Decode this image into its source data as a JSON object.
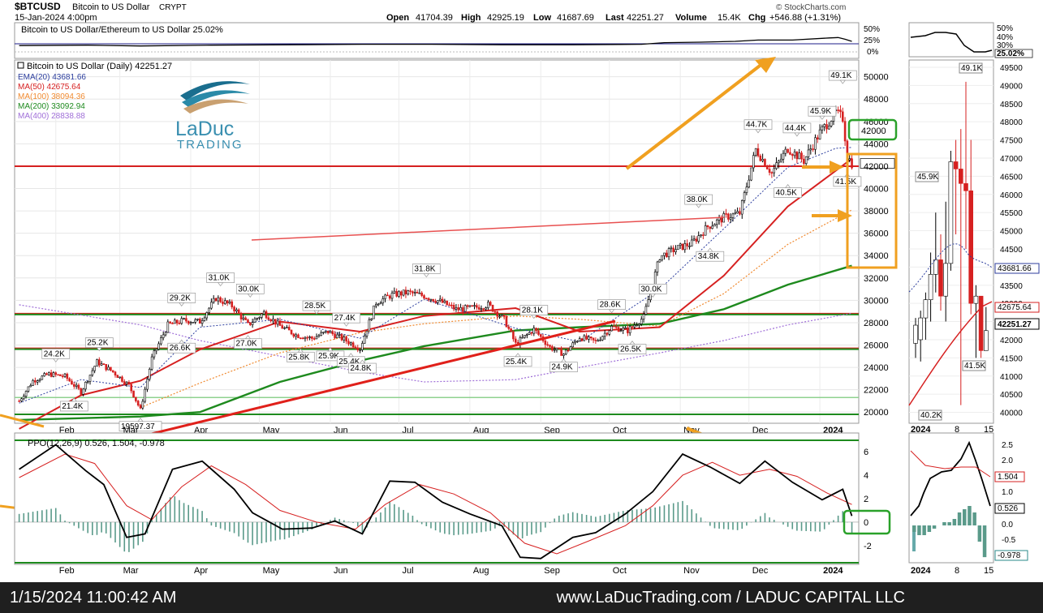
{
  "header": {
    "symbol": "$BTCUSD",
    "name": "Bitcoin to US Dollar",
    "exchange": "CRYPT",
    "date": "15-Jan-2024 4:00pm",
    "open_label": "Open",
    "open": "41704.39",
    "high_label": "High",
    "high": "42925.19",
    "low_label": "Low",
    "low": "41687.69",
    "last_label": "Last",
    "last": "42251.27",
    "volume_label": "Volume",
    "volume": "15.4K",
    "chg_label": "Chg",
    "chg": "+546.88 (+1.31%)",
    "credit": "© StockCharts.com"
  },
  "ratio_panel": {
    "label": "Bitcoin to US Dollar/Ethereum to US Dollar 25.02%",
    "ticks": [
      "50%",
      "25%",
      "0%"
    ],
    "last": "25.02%",
    "zoom_ticks": [
      "50%",
      "40%",
      "30%"
    ]
  },
  "legend": {
    "price": "Bitcoin to US Dollar (Daily) 42251.27",
    "ema20": "EMA(20) 43681.66",
    "ma50": "MA(50) 42675.64",
    "ma100": "MA(100) 38094.36",
    "ma200": "MA(200) 33092.94",
    "ma400": "MA(400) 28838.88"
  },
  "logo": {
    "line1": "LaDuc",
    "line2": "TRADING"
  },
  "ppo": {
    "label": "PPO(12,26,9) 0.526, 1.504, -0.978",
    "zoom_values": [
      "1.504",
      "0.526",
      "-0.978"
    ]
  },
  "footer": {
    "timestamp": "1/15/2024 11:00:42 AM",
    "site": "www.LaDucTrading.com / LADUC CAPITAL LLC"
  },
  "colors": {
    "price_red": "#d62020",
    "ma_green": "#1e8a1e",
    "ema_blue": "#2c3e9e",
    "ma100_orange": "#f08a30",
    "ma400_violet": "#a070d8",
    "arrow_orange": "#f0a020",
    "box_green": "#2aa12a",
    "box_orange": "#f0a020"
  },
  "chart_data": {
    "type": "line",
    "title": "Bitcoin to US Dollar (Daily)",
    "x_ticks": [
      "Feb",
      "Mar",
      "Apr",
      "May",
      "Jun",
      "Jul",
      "Aug",
      "Sep",
      "Oct",
      "Nov",
      "Dec",
      "2024"
    ],
    "y_ticks": [
      20000,
      22000,
      24000,
      26000,
      28000,
      30000,
      32000,
      34000,
      36000,
      38000,
      40000,
      42000,
      44000,
      46000,
      48000,
      50000
    ],
    "ylim": [
      19000,
      51500
    ],
    "price_path": [
      [
        "2023-01-16",
        21000
      ],
      [
        "2023-01-22",
        22800
      ],
      [
        "2023-01-29",
        23400
      ],
      [
        "2023-02-05",
        23200
      ],
      [
        "2023-02-12",
        21800
      ],
      [
        "2023-02-19",
        24500
      ],
      [
        "2023-02-26",
        23600
      ],
      [
        "2023-03-05",
        22400
      ],
      [
        "2023-03-10",
        20200
      ],
      [
        "2023-03-15",
        24800
      ],
      [
        "2023-03-22",
        27800
      ],
      [
        "2023-03-29",
        28200
      ],
      [
        "2023-04-05",
        28100
      ],
      [
        "2023-04-12",
        30200
      ],
      [
        "2023-04-19",
        29500
      ],
      [
        "2023-04-26",
        27800
      ],
      [
        "2023-05-03",
        28900
      ],
      [
        "2023-05-10",
        27700
      ],
      [
        "2023-05-17",
        26900
      ],
      [
        "2023-05-24",
        26600
      ],
      [
        "2023-05-31",
        27200
      ],
      [
        "2023-06-07",
        26500
      ],
      [
        "2023-06-14",
        25700
      ],
      [
        "2023-06-21",
        29800
      ],
      [
        "2023-06-28",
        30500
      ],
      [
        "2023-07-05",
        30700
      ],
      [
        "2023-07-12",
        30400
      ],
      [
        "2023-07-19",
        29900
      ],
      [
        "2023-07-26",
        29200
      ],
      [
        "2023-08-02",
        29300
      ],
      [
        "2023-08-09",
        29600
      ],
      [
        "2023-08-16",
        28300
      ],
      [
        "2023-08-21",
        26100
      ],
      [
        "2023-08-29",
        27400
      ],
      [
        "2023-09-05",
        25800
      ],
      [
        "2023-09-11",
        25200
      ],
      [
        "2023-09-18",
        26700
      ],
      [
        "2023-09-25",
        26300
      ],
      [
        "2023-10-02",
        27600
      ],
      [
        "2023-10-09",
        27300
      ],
      [
        "2023-10-16",
        28500
      ],
      [
        "2023-10-23",
        33900
      ],
      [
        "2023-10-30",
        34600
      ],
      [
        "2023-11-06",
        35100
      ],
      [
        "2023-11-13",
        36600
      ],
      [
        "2023-11-20",
        37400
      ],
      [
        "2023-11-27",
        37800
      ],
      [
        "2023-12-04",
        43500
      ],
      [
        "2023-12-11",
        41400
      ],
      [
        "2023-12-18",
        43600
      ],
      [
        "2023-12-25",
        42500
      ],
      [
        "2024-01-01",
        45000
      ],
      [
        "2024-01-08",
        46800
      ],
      [
        "2024-01-11",
        46300
      ],
      [
        "2024-01-13",
        42900
      ],
      [
        "2024-01-15",
        42251
      ]
    ],
    "moving_averages": {
      "ema20": [
        [
          "2023-01-16",
          20800
        ],
        [
          "2023-02-12",
          22900
        ],
        [
          "2023-03-10",
          22200
        ],
        [
          "2023-04-05",
          27600
        ],
        [
          "2023-05-10",
          28300
        ],
        [
          "2023-06-14",
          26600
        ],
        [
          "2023-07-12",
          30100
        ],
        [
          "2023-08-21",
          27500
        ],
        [
          "2023-09-18",
          26300
        ],
        [
          "2023-10-23",
          31000
        ],
        [
          "2023-11-20",
          36400
        ],
        [
          "2023-12-18",
          41900
        ],
        [
          "2024-01-08",
          43600
        ],
        [
          "2024-01-15",
          43682
        ]
      ],
      "ma50": [
        [
          "2023-01-16",
          18500
        ],
        [
          "2023-02-12",
          21500
        ],
        [
          "2023-03-10",
          22800
        ],
        [
          "2023-04-05",
          25600
        ],
        [
          "2023-05-10",
          28100
        ],
        [
          "2023-06-14",
          27200
        ],
        [
          "2023-07-12",
          28600
        ],
        [
          "2023-08-21",
          29300
        ],
        [
          "2023-09-18",
          27200
        ],
        [
          "2023-10-23",
          27600
        ],
        [
          "2023-11-20",
          32200
        ],
        [
          "2023-12-18",
          38400
        ],
        [
          "2024-01-08",
          41600
        ],
        [
          "2024-01-15",
          42676
        ]
      ],
      "ma100": [
        [
          "2023-03-10",
          20400
        ],
        [
          "2023-04-05",
          22600
        ],
        [
          "2023-05-10",
          25300
        ],
        [
          "2023-06-14",
          27100
        ],
        [
          "2023-07-12",
          27900
        ],
        [
          "2023-08-21",
          28600
        ],
        [
          "2023-09-18",
          28300
        ],
        [
          "2023-10-23",
          27700
        ],
        [
          "2023-11-20",
          30600
        ],
        [
          "2023-12-18",
          35000
        ],
        [
          "2024-01-15",
          38094
        ]
      ],
      "ma200": [
        [
          "2023-01-16",
          19300
        ],
        [
          "2023-03-10",
          19600
        ],
        [
          "2023-04-05",
          20000
        ],
        [
          "2023-05-10",
          22700
        ],
        [
          "2023-06-14",
          24600
        ],
        [
          "2023-07-12",
          25900
        ],
        [
          "2023-08-21",
          27300
        ],
        [
          "2023-09-18",
          27600
        ],
        [
          "2023-10-23",
          27900
        ],
        [
          "2023-11-20",
          29200
        ],
        [
          "2023-12-18",
          31400
        ],
        [
          "2024-01-15",
          33093
        ]
      ],
      "ma400": [
        [
          "2023-01-16",
          29600
        ],
        [
          "2023-03-10",
          27800
        ],
        [
          "2023-04-05",
          26400
        ],
        [
          "2023-05-10",
          25000
        ],
        [
          "2023-06-14",
          23600
        ],
        [
          "2023-07-12",
          22700
        ],
        [
          "2023-08-21",
          22900
        ],
        [
          "2023-09-18",
          24000
        ],
        [
          "2023-10-23",
          25300
        ],
        [
          "2023-11-20",
          26400
        ],
        [
          "2023-12-18",
          27800
        ],
        [
          "2024-01-15",
          28839
        ]
      ]
    },
    "annotations": [
      {
        "t": "2023-02-01",
        "v": 24200,
        "label": "24.2K",
        "pos": "above"
      },
      {
        "t": "2023-02-09",
        "v": 21400,
        "label": "21.4K",
        "pos": "below"
      },
      {
        "t": "2023-02-20",
        "v": 25200,
        "label": "25.2K",
        "pos": "above"
      },
      {
        "t": "2023-03-10",
        "v": 19597,
        "label": "19597.37",
        "pos": "below"
      },
      {
        "t": "2023-03-28",
        "v": 29200,
        "label": "29.2K",
        "pos": "above"
      },
      {
        "t": "2023-03-28",
        "v": 26600,
        "label": "26.6K",
        "pos": "below"
      },
      {
        "t": "2023-04-14",
        "v": 31000,
        "label": "31.0K",
        "pos": "above"
      },
      {
        "t": "2023-04-27",
        "v": 30000,
        "label": "30.0K",
        "pos": "above"
      },
      {
        "t": "2023-04-26",
        "v": 27000,
        "label": "27.0K",
        "pos": "below"
      },
      {
        "t": "2023-05-26",
        "v": 28500,
        "label": "28.5K",
        "pos": "above"
      },
      {
        "t": "2023-05-19",
        "v": 25800,
        "label": "25.8K",
        "pos": "below"
      },
      {
        "t": "2023-06-01",
        "v": 25900,
        "label": "25.9K",
        "pos": "below"
      },
      {
        "t": "2023-06-08",
        "v": 27400,
        "label": "27.4K",
        "pos": "above"
      },
      {
        "t": "2023-06-10",
        "v": 25400,
        "label": "25.4K",
        "pos": "below"
      },
      {
        "t": "2023-06-15",
        "v": 24800,
        "label": "24.8K",
        "pos": "below"
      },
      {
        "t": "2023-07-13",
        "v": 31800,
        "label": "31.8K",
        "pos": "above"
      },
      {
        "t": "2023-08-29",
        "v": 28100,
        "label": "28.1K",
        "pos": "above"
      },
      {
        "t": "2023-08-22",
        "v": 25400,
        "label": "25.4K",
        "pos": "below"
      },
      {
        "t": "2023-09-11",
        "v": 24900,
        "label": "24.9K",
        "pos": "below"
      },
      {
        "t": "2023-10-02",
        "v": 28600,
        "label": "28.6K",
        "pos": "above"
      },
      {
        "t": "2023-10-11",
        "v": 26500,
        "label": "26.5K",
        "pos": "below"
      },
      {
        "t": "2023-10-20",
        "v": 30000,
        "label": "30.0K",
        "pos": "above"
      },
      {
        "t": "2023-11-09",
        "v": 38000,
        "label": "38.0K",
        "pos": "above"
      },
      {
        "t": "2023-11-14",
        "v": 34800,
        "label": "34.8K",
        "pos": "below"
      },
      {
        "t": "2023-12-05",
        "v": 44700,
        "label": "44.7K",
        "pos": "above"
      },
      {
        "t": "2023-12-18",
        "v": 40500,
        "label": "40.5K",
        "pos": "below"
      },
      {
        "t": "2023-12-22",
        "v": 44400,
        "label": "44.4K",
        "pos": "above"
      },
      {
        "t": "2024-01-02",
        "v": 45900,
        "label": "45.9K",
        "pos": "above"
      },
      {
        "t": "2024-01-11",
        "v": 49100,
        "label": "49.1K",
        "pos": "above"
      },
      {
        "t": "2024-01-13",
        "v": 41500,
        "label": "41.5K",
        "pos": "below"
      }
    ],
    "horizontal_levels": [
      {
        "value": 42000,
        "color": "#d62020"
      },
      {
        "value": 28800,
        "color": "#d62020"
      },
      {
        "value": 28800,
        "color": "#1e8a1e"
      },
      {
        "value": 25700,
        "color": "#d62020"
      },
      {
        "value": 25700,
        "color": "#1e8a1e"
      },
      {
        "value": 21300,
        "color": "#8fd18f"
      },
      {
        "value": 19800,
        "color": "#1e8a1e"
      }
    ],
    "price_box_labels": [
      "42000"
    ],
    "right_axis_last": "42251.27",
    "zoom_panel": {
      "y_ticks": [
        40000,
        40500,
        41000,
        41500,
        42000,
        42500,
        43000,
        43500,
        44000,
        44500,
        45000,
        45500,
        46000,
        46500,
        47000,
        47500,
        48000,
        48500,
        49000,
        49500
      ],
      "ylim": [
        39700,
        49700
      ],
      "x_ticks": [
        "2024",
        "8",
        "15"
      ],
      "labels": [
        "49.1K",
        "45.9K",
        "41.5K",
        "40.2K"
      ],
      "value_tags": [
        "43681.66",
        "42675.64",
        "42251.27"
      ]
    },
    "ppo_data": {
      "y_ticks": [
        -2,
        0,
        2,
        4,
        6
      ],
      "ylim": [
        -3.6,
        7.6
      ],
      "ppo": [
        [
          "2023-01-16",
          4.5
        ],
        [
          "2023-02-01",
          6.6
        ],
        [
          "2023-02-14",
          4.4
        ],
        [
          "2023-02-22",
          3.2
        ],
        [
          "2023-03-04",
          -1.3
        ],
        [
          "2023-03-12",
          -1.0
        ],
        [
          "2023-03-24",
          4.5
        ],
        [
          "2023-04-06",
          5.2
        ],
        [
          "2023-04-20",
          2.8
        ],
        [
          "2023-04-28",
          0.8
        ],
        [
          "2023-05-11",
          -0.6
        ],
        [
          "2023-05-24",
          -0.5
        ],
        [
          "2023-06-03",
          0.1
        ],
        [
          "2023-06-15",
          -1.0
        ],
        [
          "2023-06-27",
          3.5
        ],
        [
          "2023-07-08",
          3.4
        ],
        [
          "2023-07-20",
          1.7
        ],
        [
          "2023-08-01",
          0.7
        ],
        [
          "2023-08-15",
          -0.3
        ],
        [
          "2023-08-23",
          -3.0
        ],
        [
          "2023-09-01",
          -3.1
        ],
        [
          "2023-09-15",
          -1.3
        ],
        [
          "2023-09-25",
          -0.9
        ],
        [
          "2023-10-08",
          0.7
        ],
        [
          "2023-10-20",
          2.6
        ],
        [
          "2023-11-02",
          5.8
        ],
        [
          "2023-11-14",
          4.7
        ],
        [
          "2023-11-27",
          3.3
        ],
        [
          "2023-12-08",
          5.2
        ],
        [
          "2023-12-20",
          3.4
        ],
        [
          "2024-01-02",
          1.9
        ],
        [
          "2024-01-11",
          2.8
        ],
        [
          "2024-01-15",
          0.526
        ]
      ],
      "signal": [
        [
          "2023-01-16",
          3.8
        ],
        [
          "2023-02-05",
          5.8
        ],
        [
          "2023-02-18",
          5.0
        ],
        [
          "2023-03-04",
          1.4
        ],
        [
          "2023-03-15",
          0.2
        ],
        [
          "2023-03-28",
          3.0
        ],
        [
          "2023-04-10",
          4.8
        ],
        [
          "2023-04-25",
          3.2
        ],
        [
          "2023-05-10",
          1.0
        ],
        [
          "2023-05-26",
          0.0
        ],
        [
          "2023-06-12",
          -0.6
        ],
        [
          "2023-06-25",
          1.5
        ],
        [
          "2023-07-10",
          3.2
        ],
        [
          "2023-07-25",
          2.4
        ],
        [
          "2023-08-10",
          0.8
        ],
        [
          "2023-08-25",
          -1.8
        ],
        [
          "2023-09-08",
          -2.7
        ],
        [
          "2023-09-22",
          -1.6
        ],
        [
          "2023-10-08",
          -0.3
        ],
        [
          "2023-10-20",
          1.4
        ],
        [
          "2023-11-02",
          4.0
        ],
        [
          "2023-11-15",
          5.1
        ],
        [
          "2023-11-27",
          4.0
        ],
        [
          "2023-12-10",
          4.5
        ],
        [
          "2023-12-22",
          3.9
        ],
        [
          "2024-01-04",
          2.5
        ],
        [
          "2024-01-15",
          1.504
        ]
      ],
      "histogram_last": -0.978
    }
  }
}
